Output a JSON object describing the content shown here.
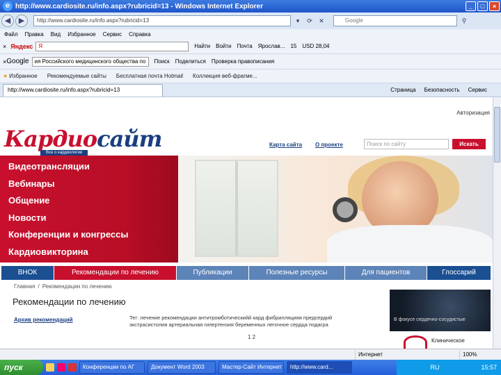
{
  "window": {
    "title": "http://www.cardiosite.ru/info.aspx?rubricid=13 - Windows Internet Explorer",
    "address": "http://www.cardiosite.ru/info.aspx?rubricid=13",
    "search_placeholder": "Google",
    "minimize": "_",
    "maximize": "□",
    "close": "×"
  },
  "menu": [
    "Файл",
    "Правка",
    "Вид",
    "Избранное",
    "Сервис",
    "Справка"
  ],
  "yandex_bar": {
    "close": "×",
    "brand": "Яндекс",
    "input_value": "Я",
    "find_label": "Найти",
    "login_label": "Войти",
    "mail_label": "Почта",
    "weather": "Ярослав...",
    "temp": "15",
    "rate": "USD 28,04"
  },
  "google_bar": {
    "close": "×",
    "brand": "Google",
    "input_value": "ия Российского медицинского общества по",
    "search_label": "Поиск",
    "share_label": "Поделиться",
    "spell_label": "Проверка правописания"
  },
  "favorites_bar": {
    "label": "Избранное",
    "items": [
      "Рекомендуемые сайты",
      "Бесплатная почта Hotmail",
      "Коллекция веб-фрагме..."
    ]
  },
  "tab": {
    "title": "http://www.cardiosite.ru/info.aspx?rubricid=13",
    "commands": [
      "Страница",
      "Безопасность",
      "Сервис"
    ]
  },
  "site": {
    "auth_link": "Авторизация",
    "logo_part1": "Кардио",
    "logo_part2": "сайт",
    "logo_sub": "Все о кардиологии",
    "header_links": [
      "Карта сайта",
      "О проекте"
    ],
    "search_placeholder": "Поиск по сайту",
    "find_button": "Искать",
    "left_menu": [
      "Видеотрансляции",
      "Вебинары",
      "Общение",
      "Новости",
      "Конференции и конгрессы",
      "Кардиовикторина"
    ],
    "nav_tabs": [
      {
        "label": "ВНОК",
        "color": "#1a4f92"
      },
      {
        "label": "Рекомендации по лечению",
        "color": "#c8102e"
      },
      {
        "label": "Публикации",
        "color": "#5d84b8"
      },
      {
        "label": "Полезные ресурсы",
        "color": "#5d84b8"
      },
      {
        "label": "Для пациентов",
        "color": "#5d84b8"
      },
      {
        "label": "Глоссарий",
        "color": "#1a4f92"
      }
    ],
    "breadcrumb": [
      "Главная",
      "/",
      "Рекомендации по лечению"
    ],
    "page_title": "Рекомендации по лечению",
    "archive_link": "Архив рекомендаций",
    "description": "Тег: лечение рекомендации антитромботическийй кард фибрилляцияя предсердий экстрасистолия артериальная гипертензия беременных легочное сердца подагра",
    "pager": "1  2",
    "banner_text": "В фокусе сердечно-сосудистые",
    "clinical_text": "Клиническое"
  },
  "status": {
    "zone": "Интернет",
    "zoom": "100%"
  },
  "taskbar": {
    "start": "пуск",
    "tasks": [
      "Конференции по АГ",
      "Документ Word 2003",
      "Мастер-Сайт Интернет",
      "http://www.card..."
    ],
    "lang": "RU",
    "clock": "15:57"
  }
}
